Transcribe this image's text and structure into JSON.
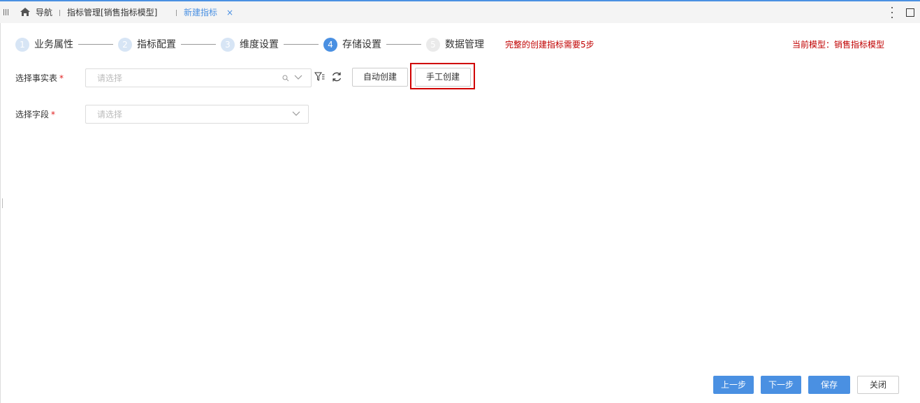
{
  "tabs": {
    "nav_label": "导航",
    "model_tab": "指标管理[销售指标模型]",
    "active_tab": "新建指标",
    "close_glyph": "×"
  },
  "steps": [
    {
      "num": "1",
      "label": "业务属性",
      "state": "done"
    },
    {
      "num": "2",
      "label": "指标配置",
      "state": "done"
    },
    {
      "num": "3",
      "label": "维度设置",
      "state": "done"
    },
    {
      "num": "4",
      "label": "存储设置",
      "state": "active"
    },
    {
      "num": "5",
      "label": "数据管理",
      "state": "disabled"
    }
  ],
  "notice": "完整的创建指标需要5步",
  "current_model": "当前模型：销售指标模型",
  "form": {
    "fact_table_label": "选择事实表",
    "fact_table_placeholder": "请选择",
    "field_label": "选择字段",
    "field_placeholder": "请选择",
    "required_mark": "*",
    "auto_create": "自动创建",
    "manual_create": "手工创建"
  },
  "footer": {
    "prev": "上一步",
    "next": "下一步",
    "save": "保存",
    "close": "关闭"
  },
  "colors": {
    "accent": "#4a90e2",
    "warning_text": "#c00000",
    "highlight": "#d00000"
  }
}
